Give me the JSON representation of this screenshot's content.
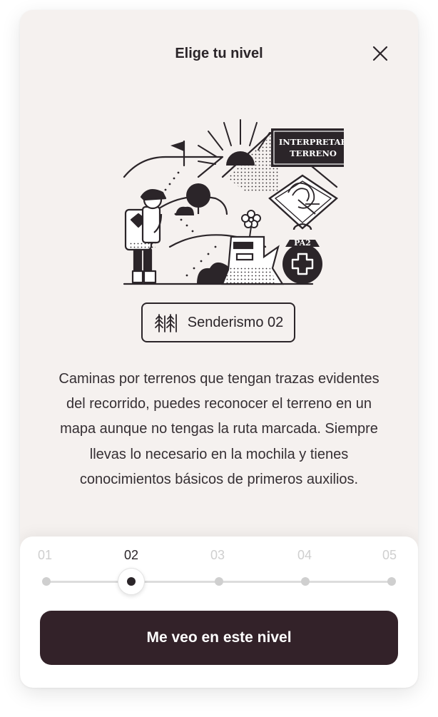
{
  "header": {
    "title": "Elige tu nivel",
    "close_icon": "close-icon"
  },
  "illustration": {
    "icon": "hiking-scene-illustration",
    "sign_line1": "INTERPRETAR",
    "sign_line2": "TERRENO",
    "medal_text": "PA2"
  },
  "badge": {
    "icon": "forest-trail-icon",
    "label": "Senderismo 02"
  },
  "description": "Caminas por terrenos que tengan trazas evidentes del recorrido, puedes reconocer el terreno en un mapa aunque no tengas la ruta marcada. Siempre llevas lo necesario en la mochila y tienes conocimientos básicos de primeros auxilios.",
  "levels": {
    "options": [
      "01",
      "02",
      "03",
      "04",
      "05"
    ],
    "selected": "02",
    "selected_index": 1
  },
  "cta": {
    "label": "Me veo en este nivel"
  },
  "colors": {
    "card_bg": "#f5f1ef",
    "ink": "#2b2529",
    "button_bg": "#332229",
    "inactive": "#cfcfcf"
  }
}
